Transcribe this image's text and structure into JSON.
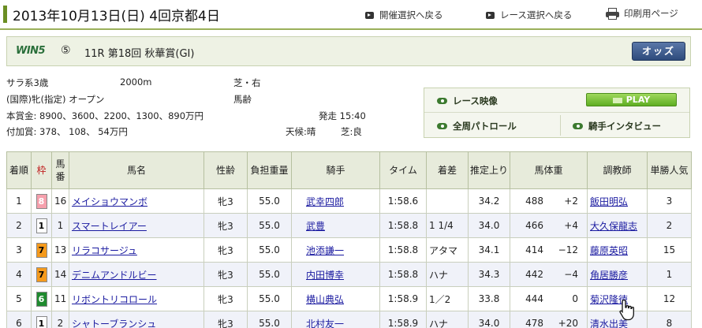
{
  "header": {
    "title": "2013年10月13日(日) 4回京都4日",
    "links": [
      "開催選択へ戻る",
      "レース選択へ戻る",
      "印刷用ページ"
    ]
  },
  "race": {
    "logo": "WIN5",
    "logo_num": "⑤",
    "title": "11R 第18回 秋華賞(GI)",
    "odds_button": "オッズ"
  },
  "info": {
    "condition": "サラ系3歳",
    "distance": "2000m",
    "course": "芝・右",
    "class": "(国際)牝(指定) オープン",
    "weight_type": "馬齢",
    "prize": "本賞金: 8900、3600、2200、1300、890万円",
    "start_time": "発走 15:40",
    "bonus": "付加賞: 378、 108、 54万円",
    "weather": "天候:晴",
    "going": "芝:良"
  },
  "video_panel": {
    "race_video": "レース映像",
    "play": "PLAY",
    "patrol": "全周パトロール",
    "interview": "騎手インタビュー"
  },
  "table": {
    "headers": [
      "着順",
      "枠",
      "馬番",
      "馬名",
      "性齢",
      "負担重量",
      "騎手",
      "タイム",
      "着差",
      "推定上り",
      "馬体重",
      "調教師",
      "単勝人気"
    ],
    "rows": [
      {
        "rank": "1",
        "waku": "8",
        "num": "16",
        "horse": "メイショウマンボ",
        "sexage": "牝3",
        "weight": "55.0",
        "jockey": "武幸四郎",
        "time": "1:58.6",
        "margin": "",
        "last3f": "34.2",
        "body": "488",
        "diff": "+2",
        "trainer": "飯田明弘",
        "pop": "3"
      },
      {
        "rank": "2",
        "waku": "1",
        "num": "1",
        "horse": "スマートレイアー",
        "sexage": "牝3",
        "weight": "55.0",
        "jockey": "武豊",
        "time": "1:58.8",
        "margin": "1 1/4",
        "last3f": "34.0",
        "body": "466",
        "diff": "+4",
        "trainer": "大久保龍志",
        "pop": "2"
      },
      {
        "rank": "3",
        "waku": "7",
        "num": "13",
        "horse": "リラコサージュ",
        "sexage": "牝3",
        "weight": "55.0",
        "jockey": "池添謙一",
        "time": "1:58.8",
        "margin": "アタマ",
        "last3f": "34.1",
        "body": "414",
        "diff": "−12",
        "trainer": "藤原英昭",
        "pop": "15"
      },
      {
        "rank": "4",
        "waku": "7",
        "num": "14",
        "horse": "デニムアンドルビー",
        "sexage": "牝3",
        "weight": "55.0",
        "jockey": "内田博幸",
        "time": "1:58.8",
        "margin": "ハナ",
        "last3f": "34.3",
        "body": "442",
        "diff": "−4",
        "trainer": "角居勝彦",
        "pop": "1"
      },
      {
        "rank": "5",
        "waku": "6",
        "num": "11",
        "horse": "リボントリコロール",
        "sexage": "牝3",
        "weight": "55.0",
        "jockey": "横山典弘",
        "time": "1:58.9",
        "margin": "1／2",
        "last3f": "33.8",
        "body": "444",
        "diff": "0",
        "trainer": "菊沢隆徳",
        "pop": "12"
      },
      {
        "rank": "6",
        "waku": "1",
        "num": "2",
        "horse": "シャトーブランシュ",
        "sexage": "牝3",
        "weight": "55.0",
        "jockey": "北村友一",
        "time": "1:58.9",
        "margin": "ハナ",
        "last3f": "34.0",
        "body": "478",
        "diff": "+20",
        "trainer": "清水出美",
        "pop": "8"
      }
    ]
  },
  "colors": {
    "accent_green": "#6b8e23",
    "odds_blue": "#2e4b7c",
    "link_blue": "#1a1aa0",
    "waku_1": "#ffffff",
    "waku_6": "#1f8a2e",
    "waku_7": "#f59a1c",
    "waku_8": "#f6a0ad"
  }
}
